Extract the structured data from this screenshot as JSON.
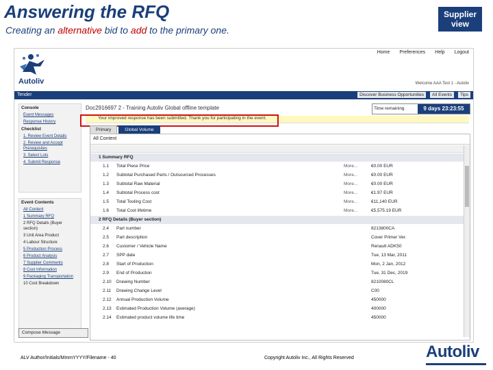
{
  "slide": {
    "title": "Answering the RFQ",
    "subtitle_pre": "Creating an ",
    "subtitle_alt": "alternative",
    "subtitle_mid": " bid to ",
    "subtitle_add": "add",
    "subtitle_post": " to the primary one.",
    "badge": "Supplier view",
    "footer_left": "ALV Author/Initials/MmmYYYY/Filename - 40",
    "footer_mid": "Copyright Autoliv Inc., All Rights Reserved",
    "brand": "Autoliv"
  },
  "app": {
    "top_links": [
      "Home",
      "Preferences",
      "Help",
      "Logout"
    ],
    "welcome": "Welcome AAA Test 1 - Autoliv",
    "logo_text": "Autoliv",
    "nav_left": "Tender",
    "nav_right": [
      "Discover Business Opportunities",
      "All Events",
      "Tips"
    ],
    "doc_title": "Doc2916697 2 - Training Autoliv Global offline template",
    "time_label": "Time remaining",
    "time_value": "9 days 23:23:55",
    "alert": "Your improved response has been submitted. Thank you for participating in the event.",
    "tabs": [
      "Primary",
      "Global Volume"
    ],
    "content_head": "All Content",
    "compose": "Compose Message"
  },
  "sidebar": {
    "console": "Console",
    "links": [
      "Event Messages",
      "Response History"
    ],
    "checklist_head": "Checklist",
    "checklist": [
      "1. Review Event Details",
      "2. Review and Accept Prerequisites",
      "3. Select Lots",
      "4. Submit Response"
    ],
    "event_head": "Event Contents",
    "event_items": [
      "All Content",
      "1 Summary RFQ",
      "2 RFQ Details (Buyer section)",
      "3 Unit Area Product",
      "4 Labour Structure",
      "5 Production Process",
      "6 Product Analysis",
      "7 Supplier Comments",
      "8 Cost Information",
      "9 Packaging Transportation",
      "10 Cost Breakdown"
    ]
  },
  "table": {
    "rows": [
      {
        "num": "",
        "label": "1  Summary RFQ",
        "action": "",
        "value": "",
        "section": true
      },
      {
        "num": "1.1",
        "label": "Total Piece Price",
        "action": "More...",
        "value": "€0.00 EUR"
      },
      {
        "num": "1.2",
        "label": "Subtotal Purchased Parts / Outsourced Processes",
        "action": "More...",
        "value": "€0.00 EUR"
      },
      {
        "num": "1.3",
        "label": "Subtotal Raw Material",
        "action": "More...",
        "value": "€0.00 EUR"
      },
      {
        "num": "1.4",
        "label": "Subtotal Process cost",
        "action": "More...",
        "value": "€1.97 EUR"
      },
      {
        "num": "1.5",
        "label": "Total Tooling Cost",
        "action": "More...",
        "value": "€11,140 EUR"
      },
      {
        "num": "1.6",
        "label": "Total Cost lifetime",
        "action": "More...",
        "value": "€5,575.19 EUR"
      },
      {
        "num": "",
        "label": "2  RFQ Details (Buyer section)",
        "action": "",
        "value": "",
        "section": true
      },
      {
        "num": "2.4",
        "label": "Part number",
        "action": "",
        "value": "8213800CA"
      },
      {
        "num": "2.5",
        "label": "Part description",
        "action": "",
        "value": "Cover Primer Ver."
      },
      {
        "num": "2.6",
        "label": "Customer / Vehicle Name",
        "action": "",
        "value": "Renault ADK50"
      },
      {
        "num": "2.7",
        "label": "SPP date",
        "action": "",
        "value": "Tue, 13 Mar, 2011"
      },
      {
        "num": "2.8",
        "label": "Start of Production",
        "action": "",
        "value": "Mon, 2 Jan, 2012"
      },
      {
        "num": "2.9",
        "label": "End of Production",
        "action": "",
        "value": "Tue, 31 Dec, 2019"
      },
      {
        "num": "2.10",
        "label": "Drawing Number",
        "action": "",
        "value": "8210080CL"
      },
      {
        "num": "2.11",
        "label": "Drawing Change Level",
        "action": "",
        "value": "C00"
      },
      {
        "num": "2.12",
        "label": "Annual Production Volume",
        "action": "",
        "value": "450000"
      },
      {
        "num": "2.13",
        "label": "Estimated Production Volume (average)",
        "action": "",
        "value": "400000"
      },
      {
        "num": "2.14",
        "label": "Estimated product volume life time",
        "action": "",
        "value": "450000"
      }
    ]
  }
}
